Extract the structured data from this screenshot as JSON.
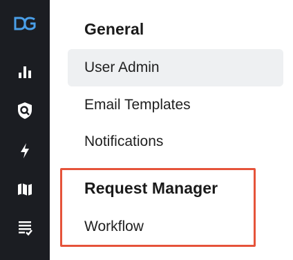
{
  "colors": {
    "rail_background": "#1b1d22",
    "icon_default": "#ffffff",
    "logo_accent": "#4a9fe8",
    "active_item_background": "#eef0f2",
    "highlight_outline": "#e5533a"
  },
  "rail": {
    "icons": [
      "dg-logo-icon",
      "bar-chart-icon",
      "shield-search-icon",
      "lightning-icon",
      "map-icon",
      "checklist-icon"
    ]
  },
  "sections": [
    {
      "heading": "General",
      "items": [
        {
          "label": "User Admin",
          "active": true
        },
        {
          "label": "Email Templates",
          "active": false
        },
        {
          "label": "Notifications",
          "active": false
        }
      ]
    },
    {
      "heading": "Request Manager",
      "highlighted": true,
      "items": [
        {
          "label": "Workflow",
          "active": false
        }
      ]
    }
  ]
}
